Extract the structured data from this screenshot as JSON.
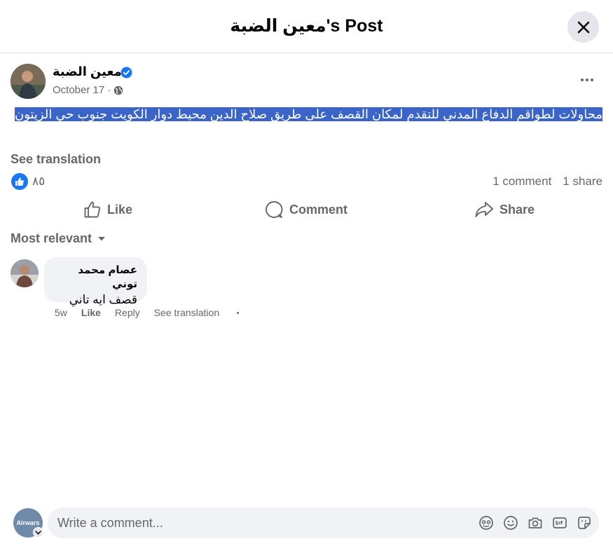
{
  "dialog": {
    "title": "معين الضبة's Post",
    "close_label": "Close"
  },
  "post": {
    "author": "معين الضبة",
    "date": "October 17",
    "separator": "·",
    "text": "محاولات لطواقم الدفاع المدني للتقدم لمكان القصف على طريق صلاح الدين محيط دوار الكويت جنوب حي الزيتون",
    "see_translation": "See translation",
    "reaction_count": "٨٥",
    "comments_count": "1 comment",
    "shares_count": "1 share"
  },
  "actions": {
    "like": "Like",
    "comment": "Comment",
    "share": "Share"
  },
  "comments_filter": "Most relevant",
  "comments": [
    {
      "author": "عصام محمد توني",
      "text": "قصف ايه تاني",
      "time": "5w",
      "like": "Like",
      "reply": "Reply",
      "see_translation": "See translation"
    }
  ],
  "composer": {
    "avatar_text": "Airwars",
    "placeholder": "Write a comment..."
  },
  "colors": {
    "accent": "#1877f2",
    "selection": "#3b64c8",
    "secondary_text": "#65676b",
    "bubble": "#f0f2f5"
  }
}
